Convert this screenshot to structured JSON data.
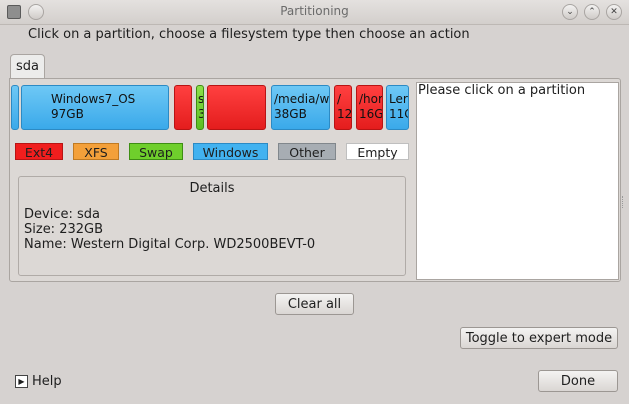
{
  "window": {
    "title": "Partitioning"
  },
  "instruction": "Click on a partition, choose a filesystem type then choose an action",
  "tabs": [
    {
      "label": "sda"
    }
  ],
  "partitions": [
    {
      "type": "windows",
      "name": "",
      "size": ""
    },
    {
      "type": "windows",
      "name": "Windows7_OS",
      "size": "97GB"
    },
    {
      "type": "ext4",
      "name": "",
      "size": ""
    },
    {
      "type": "swap",
      "name": "s",
      "size": "3"
    },
    {
      "type": "ext4",
      "name": "",
      "size": ""
    },
    {
      "type": "windows",
      "name": "/media/w",
      "size": "38GB"
    },
    {
      "type": "ext4",
      "name": "/",
      "size": "12"
    },
    {
      "type": "ext4",
      "name": "/hor",
      "size": "16G"
    },
    {
      "type": "windows",
      "name": "Ler",
      "size": "11C"
    }
  ],
  "legend": {
    "ext4": "Ext4",
    "xfs": "XFS",
    "swap": "Swap",
    "windows": "Windows",
    "other": "Other",
    "empty": "Empty"
  },
  "details": {
    "title": "Details",
    "device": "Device: sda",
    "size": "Size: 232GB",
    "name": "Name: Western Digital Corp. WD2500BEVT-0"
  },
  "info_text": "Please click on a partition",
  "buttons": {
    "clear_all": "Clear all",
    "expert_mode": "Toggle to expert mode",
    "help": "Help",
    "done": "Done"
  },
  "colors": {
    "ext4": "#f01e1e",
    "xfs": "#f3a03a",
    "swap": "#6fcf2c",
    "windows": "#42b2f0",
    "other": "#a7adb3",
    "empty": "#ffffff"
  }
}
